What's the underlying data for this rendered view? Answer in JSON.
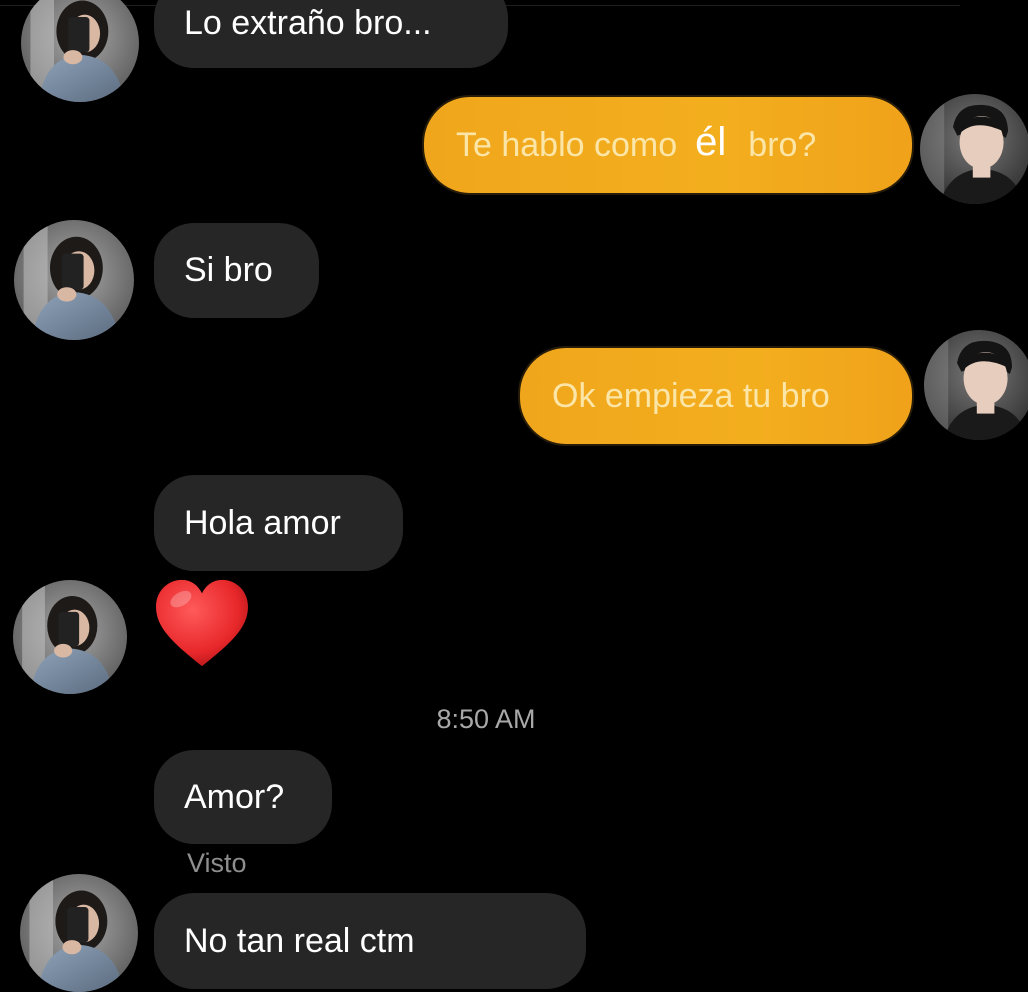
{
  "conversation": {
    "messages": [
      {
        "sender": "her",
        "text": "Lo extraño bro..."
      },
      {
        "sender": "me",
        "parts": [
          "Te hablo como",
          "él",
          "bro?"
        ]
      },
      {
        "sender": "her",
        "text": "Si bro"
      },
      {
        "sender": "me",
        "text": "Ok empieza tu bro"
      },
      {
        "sender": "her",
        "text": "Hola amor"
      },
      {
        "sender": "her",
        "emoji": "heart"
      },
      {
        "sender": "her",
        "text": "Amor?"
      },
      {
        "sender": "her",
        "text": "No tan real ctm"
      }
    ],
    "timestamp": "8:50 AM",
    "seen_label": "Visto"
  },
  "colors": {
    "incoming_bubble": "#262626",
    "outgoing_bubble": "#f0a61c",
    "background": "#000000",
    "heart": "#e8282b"
  }
}
